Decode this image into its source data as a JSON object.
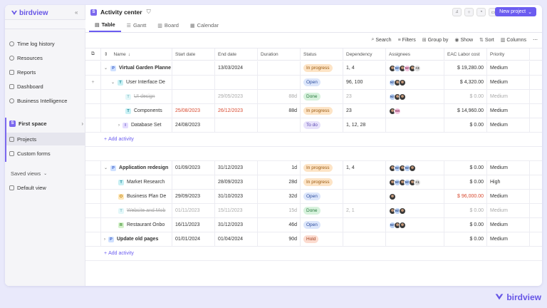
{
  "brand": {
    "name": "birdview",
    "footer_name": "birdview",
    "accent": "#6b5cf0"
  },
  "sidebar": {
    "top_items": [
      "Time log history",
      "Resources",
      "Reports",
      "Dashboard",
      "Business Intelligence"
    ],
    "space": {
      "badge": "S",
      "label": "First space"
    },
    "space_items": [
      "Projects",
      "Custom forms"
    ],
    "saved_views_label": "Saved views",
    "default_view": "Default view"
  },
  "header": {
    "badge": "S",
    "title": "Activity center",
    "new_project": "New project"
  },
  "tabs": [
    "Table",
    "Gantt",
    "Board",
    "Calendar"
  ],
  "toolbar": [
    "Search",
    "Filters",
    "Group by",
    "Show",
    "Sort",
    "Columns"
  ],
  "columns": [
    "Name",
    "Start date",
    "End date",
    "Duration",
    "Status",
    "Dependency",
    "Assignees",
    "EAC Labor cost",
    "Priority"
  ],
  "rows": [
    {
      "type": "P",
      "name": "Virtual Garden Planne",
      "start": "",
      "end": "13/03/2024",
      "dur": "",
      "status": "In progress",
      "dep": "1, 4",
      "assignees": [
        "photo",
        "NS",
        "photo",
        "NS2",
        "photo",
        "+3"
      ],
      "cost": "$ 19,280.00",
      "priority": "Medium"
    },
    {
      "type": "T",
      "name": "User Interface De",
      "start": "",
      "end": "",
      "dur": "",
      "status": "Open",
      "dep": "96, 100",
      "assignees": [
        "NS",
        "photo",
        "photo"
      ],
      "cost": "$ 4,320.00",
      "priority": "Medium"
    },
    {
      "type": "T",
      "name": "UI design",
      "start": "",
      "end": "29/05/2023",
      "dur": "88d",
      "status": "Done",
      "dep": "23",
      "assignees": [
        "NS",
        "photo",
        "photo"
      ],
      "cost": "$ 0.00",
      "priority": "Medium"
    },
    {
      "type": "T",
      "name": "Components",
      "start": "25/08/2023",
      "end": "26/12/2023",
      "dur": "88d",
      "status": "In progress",
      "dep": "23",
      "assignees": [
        "photo",
        "NS2"
      ],
      "cost": "$ 14,960.00",
      "priority": "Medium"
    },
    {
      "type": "I",
      "name": "Database Set",
      "start": "24/08/2023",
      "end": "",
      "dur": "",
      "status": "To do",
      "dep": "1, 12, 28",
      "assignees": [],
      "cost": "$ 0.00",
      "priority": "Medium"
    },
    {
      "type": "add",
      "name": "Add activity"
    },
    {
      "type": "blank"
    },
    {
      "type": "P",
      "name": "Application redesign",
      "start": "01/09/2023",
      "end": "31/12/2023",
      "dur": "1d",
      "status": "In progress",
      "dep": "1, 4",
      "assignees": [
        "photo",
        "NS",
        "photo",
        "NS",
        "photo"
      ],
      "cost": "$ 0.00",
      "priority": "Medium"
    },
    {
      "type": "T",
      "name": "Market Research",
      "start": "",
      "end": "28/09/2023",
      "dur": "28d",
      "status": "In progress",
      "dep": "",
      "assignees": [
        "photo",
        "NS",
        "photo",
        "NS",
        "photo",
        "+1"
      ],
      "cost": "$ 0.00",
      "priority": "High"
    },
    {
      "type": "O",
      "name": "Business Plan De",
      "start": "29/09/2023",
      "end": "31/10/2023",
      "dur": "32d",
      "status": "Open",
      "dep": "",
      "assignees": [
        "photo"
      ],
      "cost": "$ 96,000.00",
      "priority": "Medium"
    },
    {
      "type": "T",
      "name": "Website and Mob",
      "start": "01/11/2023",
      "end": "15/11/2023",
      "dur": "15d",
      "status": "Done",
      "dep": "2, 1",
      "assignees": [
        "photo",
        "NS",
        "photo"
      ],
      "cost": "$ 0.00",
      "priority": "Medium"
    },
    {
      "type": "R",
      "name": "Restaurant Onbo",
      "start": "16/11/2023",
      "end": "31/12/2023",
      "dur": "46d",
      "status": "Open",
      "dep": "",
      "assignees": [
        "NS",
        "photo",
        "photo"
      ],
      "cost": "$ 0.00",
      "priority": "Medium"
    },
    {
      "type": "P",
      "name": "Update old pages",
      "start": "01/01/2024",
      "end": "01/04/2024",
      "dur": "90d",
      "status": "Hold",
      "dep": "",
      "assignees": [],
      "cost": "$ 0.00",
      "priority": "Medium"
    },
    {
      "type": "add",
      "name": "Add activity"
    }
  ]
}
